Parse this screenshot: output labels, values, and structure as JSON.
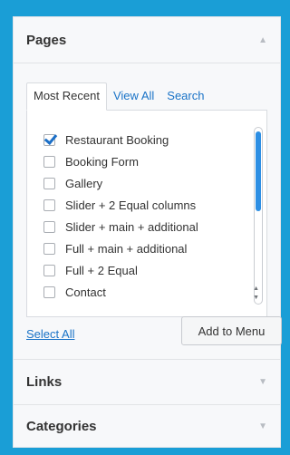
{
  "sections": {
    "pages": "Pages",
    "links": "Links",
    "categories": "Categories"
  },
  "tabs": [
    "Most Recent",
    "View All",
    "Search"
  ],
  "items": [
    {
      "label": "Restaurant Booking",
      "checked": true
    },
    {
      "label": "Booking Form",
      "checked": false
    },
    {
      "label": "Gallery",
      "checked": false
    },
    {
      "label": "Slider + 2 Equal columns",
      "checked": false
    },
    {
      "label": "Slider + main + additional",
      "checked": false
    },
    {
      "label": "Full + main + additional",
      "checked": false
    },
    {
      "label": "Full + 2 Equal",
      "checked": false
    },
    {
      "label": "Contact",
      "checked": false
    }
  ],
  "actions": {
    "select_all": "Select All",
    "add_to_menu": "Add to Menu"
  },
  "colors": {
    "background": "#1a9ed6",
    "link": "#1a73c7",
    "check": "#1b6fc7",
    "scroll_thumb": "#2d8fe4"
  }
}
